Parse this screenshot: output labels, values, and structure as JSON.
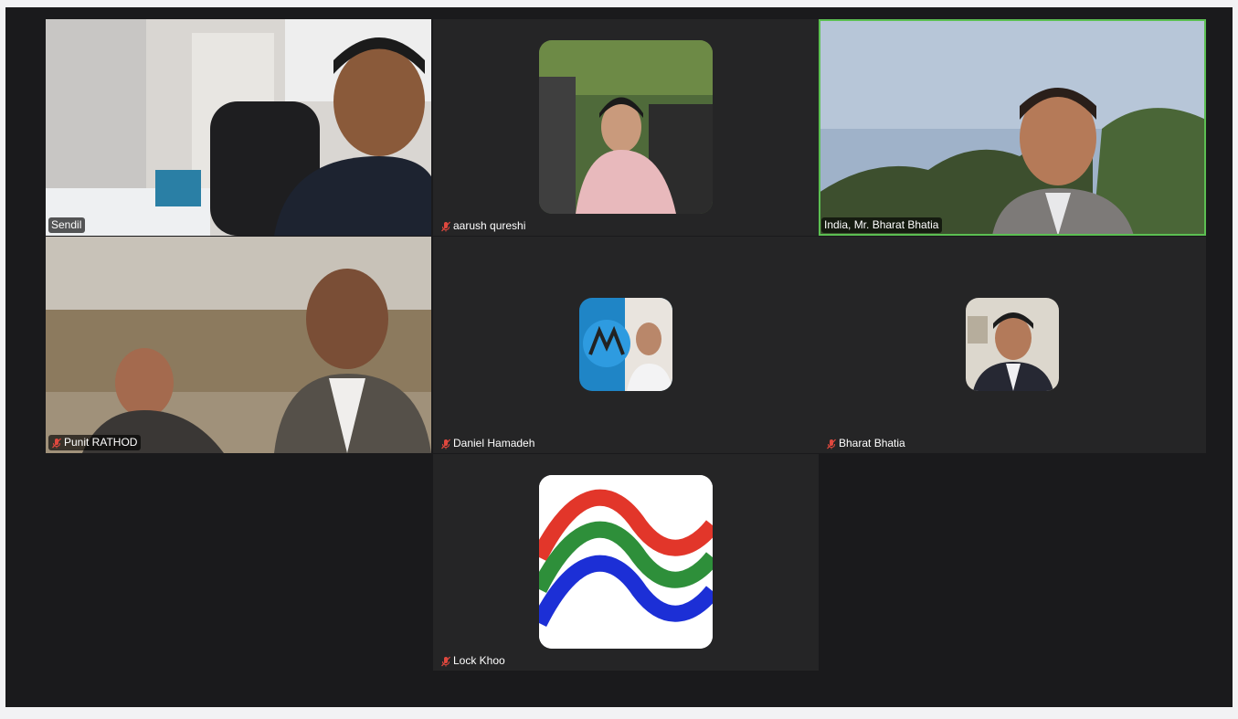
{
  "meeting": {
    "participants": [
      {
        "name": "Sendil",
        "muted": false,
        "video": true
      },
      {
        "name": "aarush qureshi",
        "muted": true,
        "video": false
      },
      {
        "name": "India, Mr. Bharat Bhatia",
        "muted": false,
        "video": true,
        "active_speaker": true
      },
      {
        "name": "Punit RATHOD",
        "muted": true,
        "video": true
      },
      {
        "name": "Daniel Hamadeh",
        "muted": true,
        "video": false
      },
      {
        "name": "Bharat Bhatia",
        "muted": true,
        "video": false
      },
      {
        "name": "Lock Khoo",
        "muted": true,
        "video": false
      }
    ]
  },
  "colors": {
    "stage_bg": "#1a1a1c",
    "tile_bg": "#252526",
    "active_speaker_border": "#5cbf52",
    "muted_icon": "#e0483e",
    "lock_logo_red": "#e2362a",
    "lock_logo_green": "#2e8f3a",
    "lock_logo_blue": "#1c2fd6"
  },
  "icons": {
    "muted": "mic-muted-icon"
  }
}
